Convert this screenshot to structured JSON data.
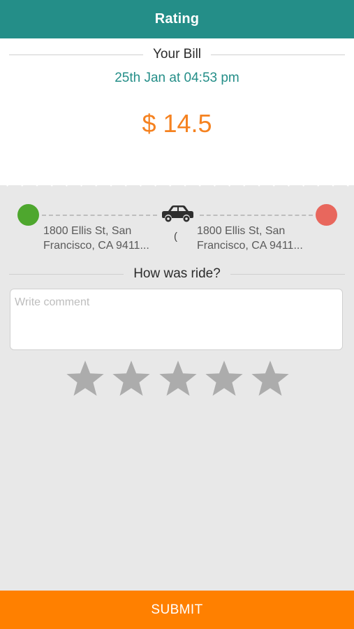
{
  "header": {
    "title": "Rating"
  },
  "bill": {
    "section_label": "Your Bill",
    "date": "25th Jan at 04:53 pm",
    "amount": "$ 14.5"
  },
  "route": {
    "from": {
      "line1": "1800 Ellis St, San",
      "line2": "Francisco, CA 9411..."
    },
    "to": {
      "line1": "1800 Ellis St, San",
      "line2": "Francisco, CA 9411..."
    },
    "loading_glyph": "("
  },
  "rating": {
    "question": "How was ride?",
    "comment_placeholder": "Write comment",
    "comment_value": "",
    "stars_total": 5,
    "stars_selected": 0
  },
  "footer": {
    "submit_label": "SUBMIT"
  },
  "colors": {
    "header_bg": "#248e88",
    "accent_teal": "#248e88",
    "amount_orange": "#f58220",
    "submit_bg": "#ff8000",
    "start_dot": "#4ea72e",
    "end_dot": "#e8675d",
    "star_inactive": "#acacac"
  },
  "icons": {
    "car": "car-icon",
    "start": "pickup-dot-icon",
    "end": "dropoff-dot-icon",
    "star": "star-icon"
  }
}
